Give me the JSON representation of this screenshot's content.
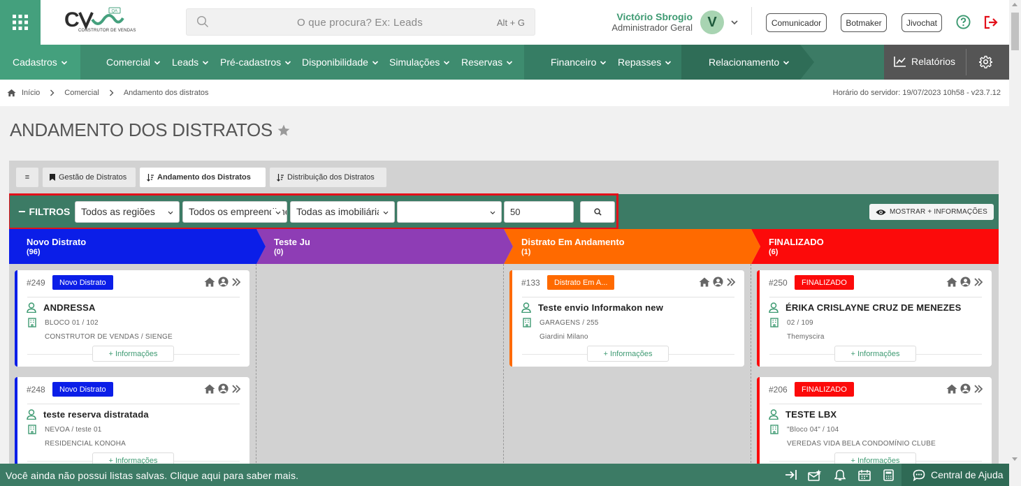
{
  "header": {
    "search_placeholder": "O que procura? Ex: Leads",
    "search_hotkey": "Alt + G",
    "user_name": "Victório Sbrogio",
    "user_role": "Administrador Geral",
    "avatar_letter": "V",
    "logo_text": "CONSTRUTOR DE VENDAS",
    "buttons": [
      "Comunicador",
      "Botmaker",
      "Jivochat"
    ]
  },
  "nav": {
    "items": [
      "Cadastros",
      "Comercial",
      "Leads",
      "Pré-cadastros",
      "Disponibilidade",
      "Simulações",
      "Reservas",
      "Financeiro",
      "Repasses",
      "Relacionamento"
    ],
    "relatorios": "Relatórios"
  },
  "breadcrumb": {
    "items": [
      "Início",
      "Comercial",
      "Andamento dos distratos"
    ],
    "server_time": "Horário do servidor: 19/07/2023 10h58 - v23.7.12"
  },
  "page": {
    "title": "ANDAMENTO DOS DISTRATOS"
  },
  "tabs": {
    "menu": "≡",
    "items": [
      "Gestão de Distratos",
      "Andamento dos Distratos",
      "Distribuição dos Distratos"
    ]
  },
  "filters": {
    "label": "FILTROS",
    "regions": "Todos as regiões",
    "ventures": "Todos os empreendimentos",
    "brokers": "Todas as imobiliárias",
    "extra": "",
    "limit": "50",
    "more_info": "MOSTRAR + INFORMAÇÕES"
  },
  "columns": [
    {
      "title": "Novo Distrato",
      "count": "(96)",
      "color": "#0b1ee8"
    },
    {
      "title": "Teste Ju",
      "count": "(0)",
      "color": "#8e3db5"
    },
    {
      "title": "Distrato Em Andamento",
      "count": "(1)",
      "color": "#ff6a00"
    },
    {
      "title": "FINALIZADO",
      "count": "(6)",
      "color": "#fc0a0a"
    }
  ],
  "cards": [
    {
      "id": "#249",
      "badge": "Novo Distrato",
      "name": "ANDRESSA",
      "unit": "BLOCO 01 / 102",
      "project": "CONSTRUTOR DE VENDAS / SIENGE",
      "info": "+ Informações"
    },
    {
      "id": "#248",
      "badge": "Novo Distrato",
      "name": "teste reserva distratada",
      "unit": "NEVOA / teste 01",
      "project": "RESIDENCIAL KONOHA",
      "info": "+ Informações"
    },
    {
      "id": "#133",
      "badge": "Distrato Em A...",
      "name": "Teste envio Informakon new",
      "unit": "GARAGENS / 255",
      "project": "Giardini Milano",
      "info": "+ Informações"
    },
    {
      "id": "#250",
      "badge": "FINALIZADO",
      "name": "ÉRIKA CRISLAYNE CRUZ DE MENEZES",
      "unit": "02 / 109",
      "project": "Themyscira",
      "info": "+ Informações"
    },
    {
      "id": "#206",
      "badge": "FINALIZADO",
      "name": "TESTE LBX",
      "unit": "\"Bloco 04\" / 104",
      "project": "VEREDAS VIDA BELA CONDOMÍNIO CLUBE",
      "info": "+ Informações"
    }
  ],
  "footer": {
    "message": "Você ainda não possui listas salvas. Clique aqui para saber mais.",
    "help_center": "Central de Ajuda"
  }
}
